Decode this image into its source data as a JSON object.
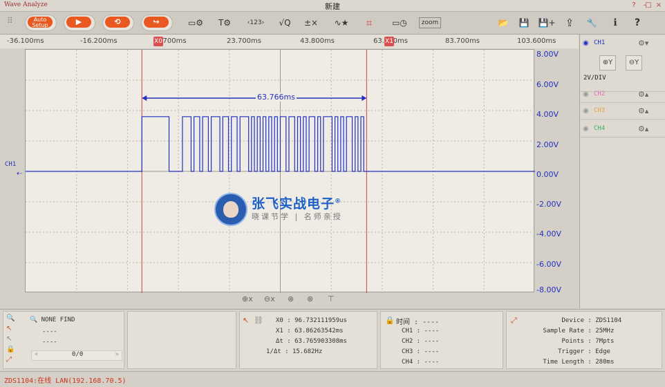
{
  "window": {
    "app_title": "Wave Analyze",
    "doc_title": "新建",
    "buttons": [
      "?",
      "–",
      "□",
      "×"
    ]
  },
  "toolbar": {
    "auto_setup_label_1": "Auto",
    "auto_setup_label_2": "Setup",
    "play_glyph": "▶",
    "loop_glyph": "⟲",
    "single_glyph": "↪",
    "zoom_label": "zoom",
    "icons": {
      "display-settings": "▭⚙",
      "text-settings": "T⚙",
      "decode": "‹123›",
      "measure": "√Q",
      "math": "±×",
      "wave-star": "∿★",
      "crop": "⌗",
      "screen-record": "▭◷",
      "open": "📂",
      "save": "💾",
      "save-as": "💾+",
      "export": "⇪",
      "tools": "🔧",
      "info": "ℹ",
      "help": "?"
    }
  },
  "ruler": {
    "ticks": [
      "-36.100ms",
      "-16.200ms",
      "3.700ms",
      "23.700ms",
      "43.800ms",
      "63.700ms",
      "83.700ms",
      "103.600ms"
    ],
    "cursor_x0": "X0",
    "cursor_x1": "X1"
  },
  "y_axis": {
    "ticks": [
      "8.00V",
      "6.00V",
      "4.00V",
      "2.00V",
      "0.00V",
      "-2.00V",
      "-4.00V",
      "-6.00V",
      "-8.00V"
    ]
  },
  "plot": {
    "ch_label": "CH1",
    "zero_marker": "⇠",
    "measure_delta": "63.766ms",
    "colors": {
      "trace": "#2030c0",
      "cursor": "#d04040",
      "grid": "#b8b4a8",
      "background": "#efece6"
    },
    "waveform": {
      "baseline_v": 0,
      "high_v": 3.6,
      "pre_high_start_ms": 0,
      "pre_high_end_ms": 7.7,
      "burst_start_ms": 11.5,
      "burst_end_ms": 63.7
    }
  },
  "watermark": {
    "title": "张飞实战电子",
    "registered": "®",
    "subtitle": "晓课节学 | 名师亲授"
  },
  "bottom_tools": [
    "⊕x",
    "⊖x",
    "⊗",
    "⊗",
    "⊤"
  ],
  "side_panel": {
    "channels": [
      {
        "name": "CH1",
        "color": "#2030c0"
      },
      {
        "name": "CH2",
        "color": "#e070c0"
      },
      {
        "name": "CH3",
        "color": "#e8a040"
      },
      {
        "name": "CH4",
        "color": "#40b060"
      }
    ],
    "zoom_in": "⊕Y",
    "zoom_out": "⊖Y",
    "vdiv": "2V/DIV"
  },
  "find_panel": {
    "title": "NONE FIND",
    "line1": "----",
    "line2": "----",
    "counter": "0/0"
  },
  "cursor_panel": {
    "x0_label": "X0",
    "x0_value": "96.732111959us",
    "x1_label": "X1",
    "x1_value": "63.86263542ms",
    "dt_label": "Δt",
    "dt_value": "63.765903308ms",
    "inv_dt_label": "1/Δt",
    "inv_dt_value": "15.682Hz"
  },
  "time_panel": {
    "title": "时间",
    "title_value": "----",
    "rows": [
      {
        "label": "CH1",
        "value": "----"
      },
      {
        "label": "CH2",
        "value": "----"
      },
      {
        "label": "CH3",
        "value": "----"
      },
      {
        "label": "CH4",
        "value": "----"
      }
    ]
  },
  "device_panel": {
    "rows": [
      {
        "label": "Device",
        "value": "ZDS1104"
      },
      {
        "label": "Sample Rate",
        "value": "25MHz"
      },
      {
        "label": "Points",
        "value": "7Mpts"
      },
      {
        "label": "Trigger",
        "value": "Edge"
      },
      {
        "label": "Time Length",
        "value": "280ms"
      }
    ]
  },
  "status": {
    "text": "ZDS1104:在线 LAN(192.168.70.5)"
  }
}
